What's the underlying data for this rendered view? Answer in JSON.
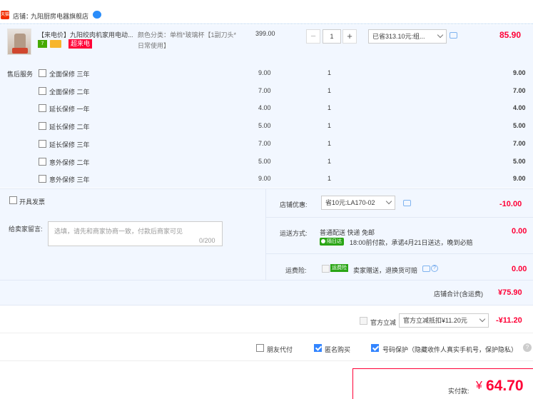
{
  "shop": {
    "badge": "天猫",
    "label": "店铺：",
    "name": "九阳厨房电器旗舰店"
  },
  "item": {
    "title": "【来电价】九阳绞肉机家用电动...",
    "tag_7day": "7",
    "tag_sale": "超来电",
    "spec": "颜色分类：单档*玻璃杯【1副刀头*日常使用】",
    "unit_price": "399.00",
    "quantity": "1",
    "discount_option": "已省313.10元:组...",
    "subtotal": "85.90"
  },
  "services": {
    "label": "售后服务",
    "rows": [
      {
        "name": "全面保修 三年",
        "price": "9.00",
        "qty": "1",
        "total": "9.00"
      },
      {
        "name": "全面保修 二年",
        "price": "7.00",
        "qty": "1",
        "total": "7.00"
      },
      {
        "name": "延长保修 一年",
        "price": "4.00",
        "qty": "1",
        "total": "4.00"
      },
      {
        "name": "延长保修 二年",
        "price": "5.00",
        "qty": "1",
        "total": "5.00"
      },
      {
        "name": "延长保修 三年",
        "price": "7.00",
        "qty": "1",
        "total": "7.00"
      },
      {
        "name": "意外保修 二年",
        "price": "5.00",
        "qty": "1",
        "total": "5.00"
      },
      {
        "name": "意外保修 三年",
        "price": "9.00",
        "qty": "1",
        "total": "9.00"
      }
    ]
  },
  "invoice": {
    "label": "开具发票"
  },
  "memo": {
    "label": "给卖家留言:",
    "placeholder": "选填，请先和商家协商一致，付款后商家可见",
    "count": "0/200"
  },
  "coupon": {
    "label": "店铺优惠:",
    "selected": "省10元:LA170-02",
    "amount": "-10.00"
  },
  "shipping": {
    "label": "运送方式:",
    "method": "普通配送 快递 免邮",
    "tag": "隔日达",
    "time": "18:00前付款，承诺4月21日送达，晚到必赔",
    "cost": "0.00"
  },
  "insurance": {
    "label": "运费险:",
    "tag": "运费险",
    "desc": "卖家赠送，退换货可赔",
    "help": "?",
    "cost": "0.00"
  },
  "shop_total": {
    "label": "店铺合计(含运费)",
    "amount": "¥75.90"
  },
  "official": {
    "label": "官方立减",
    "selected": "官方立减抵扣¥11.20元",
    "amount": "-¥11.20"
  },
  "options": {
    "friend_pay": "朋友代付",
    "anonymous": "匿名购买",
    "phone_protect": "号码保护（隐藏收件人真实手机号，保护隐私）",
    "help": "?"
  },
  "payment": {
    "label": "实付款:",
    "currency": "¥",
    "amount": "64.70"
  },
  "colors": {
    "accent_red": "#ff0036",
    "panel_blue": "#f2f7ff",
    "check_blue": "#3385ff",
    "tag_green": "#2aa515"
  }
}
